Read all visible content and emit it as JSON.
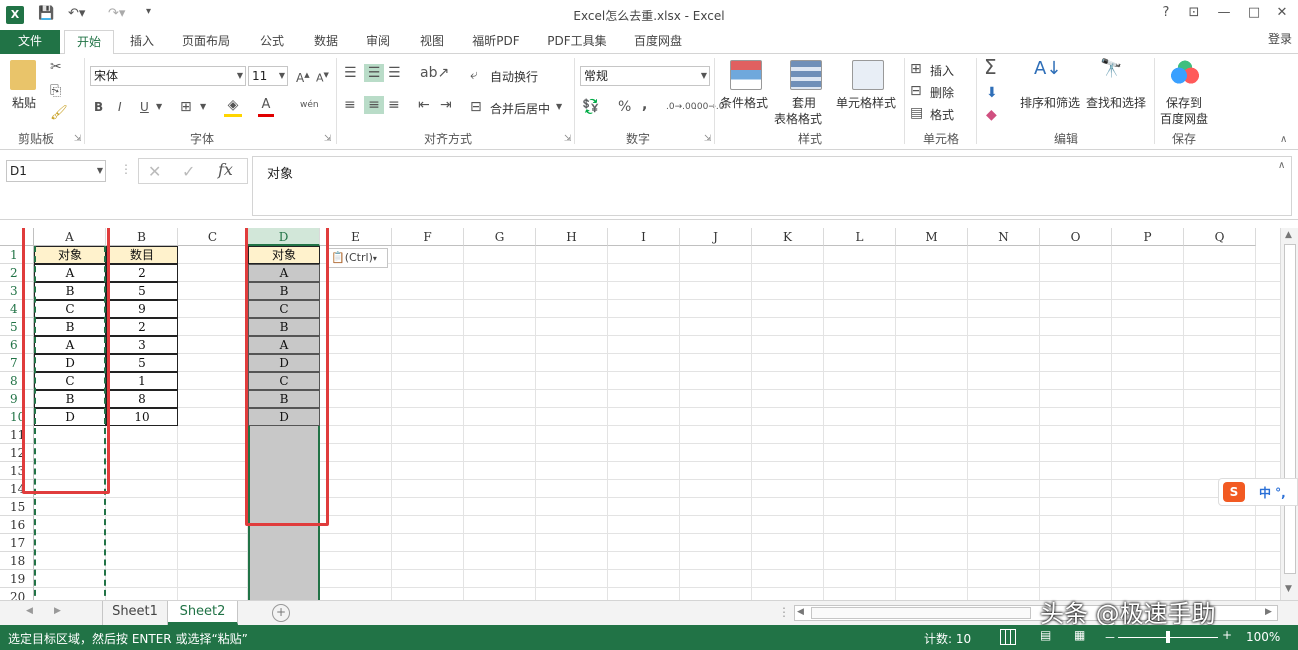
{
  "title": "Excel怎么去重.xlsx - Excel",
  "window": {
    "help": "?",
    "minimize": "—",
    "restore": "□",
    "close": "✕",
    "login": "登录"
  },
  "tabs": [
    "文件",
    "开始",
    "插入",
    "页面布局",
    "公式",
    "数据",
    "审阅",
    "视图",
    "福昕PDF",
    "PDF工具集",
    "百度网盘"
  ],
  "ribbon": {
    "clipboard": {
      "label": "剪贴板",
      "paste": "粘贴"
    },
    "font": {
      "label": "字体",
      "font_name": "宋体",
      "font_size": "11",
      "bold": "B",
      "italic": "I",
      "underline": "U",
      "phonetic": "wén"
    },
    "alignment": {
      "label": "对齐方式",
      "wrap": "自动换行",
      "merge": "合并后居中"
    },
    "number": {
      "label": "数字",
      "format": "常规",
      "percent": "%",
      "comma": ","
    },
    "styles": {
      "label": "样式",
      "conditional": "条件格式",
      "table_fmt_1": "套用",
      "table_fmt_2": "表格格式",
      "cell_styles": "单元格样式"
    },
    "cells": {
      "label": "单元格",
      "insert": "插入",
      "delete": "删除",
      "format": "格式"
    },
    "editing": {
      "label": "编辑",
      "sort": "排序和筛选",
      "find": "查找和选择"
    },
    "save": {
      "label": "保存",
      "btn1": "保存到",
      "btn2": "百度网盘"
    }
  },
  "formula_bar": {
    "name_box": "D1",
    "cancel": "✕",
    "enter": "✓",
    "fx": "fx",
    "content": "对象"
  },
  "columns": [
    "A",
    "B",
    "C",
    "D",
    "E",
    "F",
    "G",
    "H",
    "I",
    "J",
    "K",
    "L",
    "M",
    "N",
    "O",
    "P",
    "Q"
  ],
  "rows": [
    "1",
    "2",
    "3",
    "4",
    "5",
    "6",
    "7",
    "8",
    "9",
    "10",
    "11",
    "12",
    "13",
    "14",
    "15",
    "16",
    "17",
    "18",
    "19",
    "20"
  ],
  "table_a": {
    "header_obj": "对象",
    "header_num": "数目",
    "objects": [
      "A",
      "B",
      "C",
      "B",
      "A",
      "D",
      "C",
      "B",
      "D"
    ],
    "numbers": [
      "2",
      "5",
      "9",
      "2",
      "3",
      "5",
      "1",
      "8",
      "10"
    ]
  },
  "table_d": {
    "header": "对象",
    "values": [
      "A",
      "B",
      "C",
      "B",
      "A",
      "D",
      "C",
      "B",
      "D"
    ]
  },
  "paste_options": "(Ctrl)",
  "sheets": [
    "Sheet1",
    "Sheet2"
  ],
  "active_sheet": "Sheet2",
  "status": {
    "message": "选定目标区域，然后按 ENTER 或选择“粘贴”",
    "count": "计数: 10",
    "zoom": "100%",
    "zoom_minus": "－",
    "zoom_plus": "+"
  },
  "ime": {
    "brand": "S",
    "label": "中 °,"
  },
  "watermark": "头条 @极速手助",
  "colors": {
    "excel_green": "#217346",
    "highlight_red": "#e03c3c",
    "header_fill": "#fff2cc",
    "selection_gray": "#c8c8c8"
  }
}
